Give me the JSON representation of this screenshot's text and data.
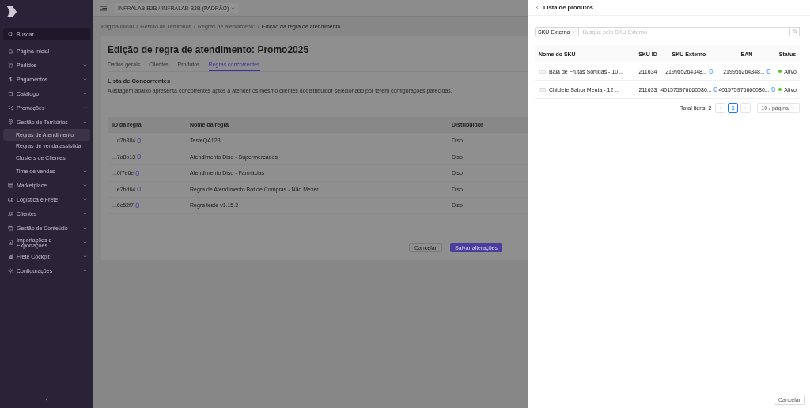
{
  "sidebar": {
    "search_placeholder": "Buscar",
    "items": [
      {
        "label": "Página inicial",
        "kind": "link"
      },
      {
        "label": "Pedidos",
        "kind": "group",
        "expanded": false
      },
      {
        "label": "Pagamentos",
        "kind": "group",
        "expanded": false
      },
      {
        "label": "Catálogo",
        "kind": "group",
        "expanded": false
      },
      {
        "label": "Promoções",
        "kind": "group",
        "expanded": false
      },
      {
        "label": "Gestão de Territórios",
        "kind": "group",
        "expanded": true,
        "children": [
          {
            "label": "Regras de Atendimento",
            "selected": true,
            "kind": "link"
          },
          {
            "label": "Regras de venda assistida",
            "selected": false,
            "kind": "link"
          },
          {
            "label": "Clusters de Clientes",
            "selected": false,
            "kind": "link"
          },
          {
            "label": "Time de vendas",
            "selected": false,
            "kind": "group"
          }
        ]
      },
      {
        "label": "Marketplace",
        "kind": "group",
        "expanded": false
      },
      {
        "label": "Logística e Frete",
        "kind": "group",
        "expanded": false
      },
      {
        "label": "Clientes",
        "kind": "group",
        "expanded": false
      },
      {
        "label": "Gestão de Conteúdo",
        "kind": "group",
        "expanded": false
      },
      {
        "label": "Importações e Exportações",
        "kind": "group",
        "expanded": false
      },
      {
        "label": "Frete Cockpit",
        "kind": "group",
        "expanded": false
      },
      {
        "label": "Configurações",
        "kind": "group",
        "expanded": false
      }
    ]
  },
  "topbar": {
    "organization": "INFRALAB B2B / INFRALAB B2B (PADRÃO)"
  },
  "breadcrumb_separator": "/",
  "breadcrumb": [
    "Página inicial",
    "Gestão de Territórios",
    "Regras de atendimento",
    "Edição da regra de atendimento"
  ],
  "page": {
    "title": "Edição de regra de atendimento: Promo2025",
    "tabs": [
      {
        "label": "Dados gerais",
        "selected": false
      },
      {
        "label": "Clientes",
        "selected": false
      },
      {
        "label": "Produtos",
        "selected": false
      },
      {
        "label": "Regras concorrentes",
        "selected": true
      }
    ],
    "section_title": "Lista de Concorrentes",
    "description": "A listagem abaixo apresenta concorrentes aptos a atender os mesmo clientes dodistribuidor selecionado por terem configurações parecidas.",
    "table": {
      "columns": [
        "ID da regra",
        "Nome da regra",
        "Distribuidor"
      ],
      "rows": [
        {
          "id": "...d7b884",
          "name": "TesteQA123",
          "distributor": "Diso"
        },
        {
          "id": "...7a8b13",
          "name": "Atendimento Diso - Supermercados",
          "distributor": "Diso"
        },
        {
          "id": "...0f7e6e",
          "name": "Atendimento Diso - Farmácias",
          "distributor": "Diso"
        },
        {
          "id": "...e7bd64",
          "name": "Regra de Atendimento Bot de Compras - Não Mexer",
          "distributor": "Diso"
        },
        {
          "id": "...6c52f7",
          "name": "Regra teste v1.15.3",
          "distributor": "Diso"
        }
      ]
    },
    "buttons": {
      "cancel": "Cancelar",
      "save": "Salvar alterações"
    }
  },
  "drawer": {
    "title": "Lista de produtos",
    "search": {
      "filter": "SKU Externo",
      "placeholder": "Busque pelo SKU Externo"
    },
    "table": {
      "columns": [
        "Nome do SKU",
        "SKU ID",
        "SKU Externo",
        "EAN",
        "Status"
      ],
      "rows": [
        {
          "name": "Bala de Frutas Sortidas - 10...",
          "sku_id": "211634",
          "sku_externo": "219955264348...",
          "ean": "219955264348...",
          "status": "Ativo",
          "color": "#52c41a"
        },
        {
          "name": "Chiclete Sabor Menta - 12 ...",
          "sku_id": "211633",
          "sku_externo": "401575976660080...",
          "ean": "401575976660080...",
          "status": "Ativo",
          "color": "#52c41a"
        }
      ]
    },
    "pagination": {
      "total": "Total itens: 2",
      "pages": [
        {
          "label": "1",
          "selected": true
        }
      ],
      "prev_disabled": true,
      "next_disabled": true,
      "page_size": "10 / página"
    },
    "footer_button": "Cancelar"
  }
}
